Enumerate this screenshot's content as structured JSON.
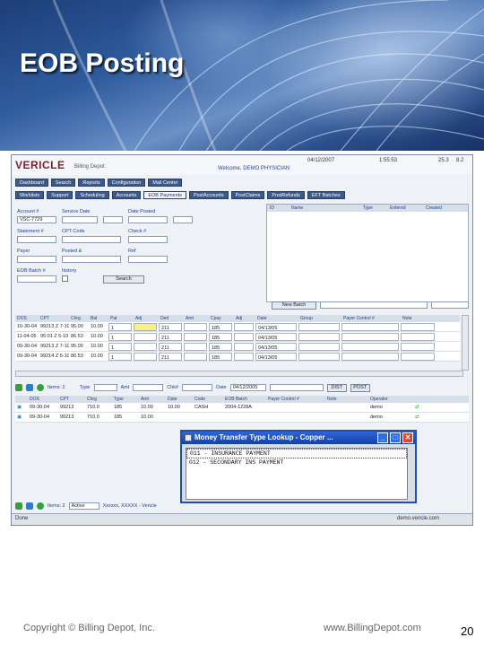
{
  "slide": {
    "title": "EOB Posting",
    "footer_copyright": "Copyright © Billing Depot, Inc.",
    "footer_url": "www.BillingDepot.com",
    "page_number": "20"
  },
  "app": {
    "logo": "VERICLE",
    "logo_sub": "Billing Depot",
    "welcome": "Welcome, DEMO PHYSICIAN",
    "header_date": "04/12/2007",
    "header_time": "1:55:53",
    "header_v1": "25.3",
    "header_v2": "8.2",
    "tabs_row1": [
      "Dashboard",
      "Search",
      "Reports",
      "Configuration",
      "Mail Center"
    ],
    "tabs_row2": [
      "Worklists",
      "Support",
      "Scheduling",
      "Accounts",
      "EOB Payments",
      "PostAccounts",
      "PostClaims",
      "PostRefunds",
      "EFT Batches"
    ],
    "active_tab_row2": "EOB Payments",
    "form": {
      "account_label": "Account #",
      "account_value": "VSC-7729",
      "service_date_label": "Service Date",
      "date_posted_label": "Date Posted",
      "statement_label": "Statement #",
      "cpt_code_label": "CPT Code",
      "check_label": "Check #",
      "payer_label": "Payer",
      "posted_label": "Posted &",
      "ref_label": "Ref",
      "eob_batch_label": "EOB Batch #",
      "history_label": "history",
      "search_button": "Search",
      "new_batch_button": "New Batch"
    },
    "right_panel_headers": [
      "ID",
      "Name",
      "Type",
      "Entered",
      "Created"
    ],
    "grid_headers": [
      "DOS",
      "CPT",
      "Chrg",
      "Bal",
      "Pat",
      "Adj",
      "Ded",
      "Amt",
      "Cpay",
      "Adj",
      "Date",
      "Group",
      "Payer Control #",
      "Note"
    ],
    "grid_rows": [
      [
        "10-30-04",
        "99213 Z 7-10",
        "95.00",
        "10.00",
        "1",
        "1",
        "211",
        "",
        "185",
        "04/13/05",
        "",
        "",
        ""
      ],
      [
        "11-04-05",
        "95:01 Z 5-10",
        "86.53",
        "10.00",
        "1",
        "1",
        "211",
        "",
        "185",
        "04/13/05",
        "",
        "",
        ""
      ],
      [
        "09-30-04",
        "99213 Z 7-10",
        "95.00",
        "10.00",
        "1",
        "1",
        "211",
        "",
        "185",
        "04/13/05",
        "",
        "",
        ""
      ],
      [
        "09-30-04",
        "99214 Z 5-10",
        "86.53",
        "10.00",
        "1",
        "1",
        "211",
        "",
        "185",
        "04/13/05",
        "",
        "",
        ""
      ]
    ],
    "toolbar2": {
      "items_label": "Items: 2",
      "type_label": "Type",
      "amt_label": "Amt",
      "chk_label": "Chk#",
      "date_label": "Date",
      "date_value": "04/12/2005",
      "dist_button": "DIST",
      "post_button": "POST"
    },
    "grid2_headers": [
      "DOS",
      "CPT",
      "Chrg",
      "Type",
      "Amt",
      "Date",
      "Code",
      "EOB Batch",
      "Payer Control #",
      "Note",
      "Operator"
    ],
    "grid2_rows": [
      [
        "09-30-04",
        "99213",
        "710.0",
        "185",
        "10.00",
        "10.00",
        "CASH",
        "2004-1228A",
        "",
        "",
        "demo"
      ],
      [
        "09-30-04",
        "99213",
        "710.0",
        "185",
        "10.00",
        "",
        "",
        "",
        "",
        "",
        "demo"
      ]
    ],
    "dialog": {
      "title": "Money Transfer Type Lookup - Copper ...",
      "options": [
        "011 - INSURANCE PAYMENT",
        "012 - SECONDARY INS PAYMENT"
      ]
    },
    "toolbar3": {
      "items_label": "Items: 2",
      "status_select": "Active",
      "user_text": "Xxxxxx, XXXXX - Vericle"
    },
    "status_left": "Done",
    "status_right": "demo.vericle.com"
  }
}
